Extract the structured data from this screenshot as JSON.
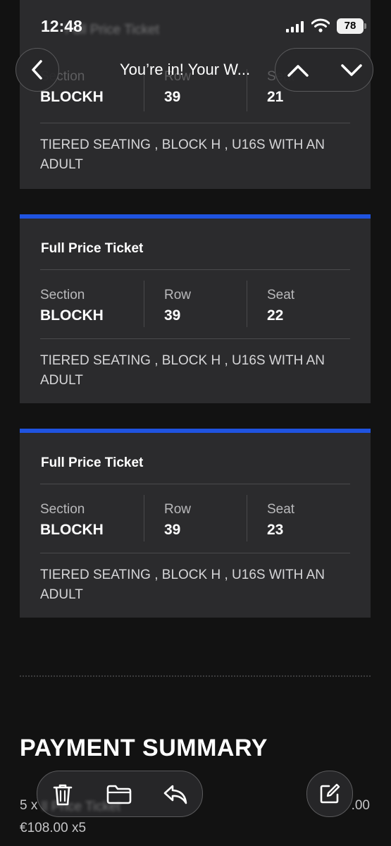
{
  "status_bar": {
    "time": "12:48",
    "battery": "78"
  },
  "nav": {
    "title": "You’re in! Your W..."
  },
  "labels": {
    "section": "Section",
    "row": "Row",
    "seat": "Seat"
  },
  "tickets": [
    {
      "title": "Full Price Ticket",
      "section": "BLOCKH",
      "row": "39",
      "seat": "21",
      "desc": "TIERED SEATING , BLOCK H , U16S WITH AN ADULT"
    },
    {
      "title": "Full Price Ticket",
      "section": "BLOCKH",
      "row": "39",
      "seat": "22",
      "desc": "TIERED SEATING , BLOCK H , U16S WITH AN ADULT"
    },
    {
      "title": "Full Price Ticket",
      "section": "BLOCKH",
      "row": "39",
      "seat": "23",
      "desc": "TIERED SEATING , BLOCK H , U16S WITH AN ADULT"
    }
  ],
  "payment": {
    "title": "PAYMENT SUMMARY",
    "line_prefix": "5 x",
    "line_total": ".00",
    "unit": "€108.00 x5"
  },
  "colors": {
    "accent": "#1f53e0",
    "card": "#2b2b2d",
    "background": "#121212"
  },
  "icons": [
    "back-chevron-icon",
    "chevron-up-icon",
    "chevron-down-icon",
    "trash-icon",
    "folder-icon",
    "reply-icon",
    "compose-icon",
    "signal-icon",
    "wifi-icon",
    "battery-icon"
  ]
}
